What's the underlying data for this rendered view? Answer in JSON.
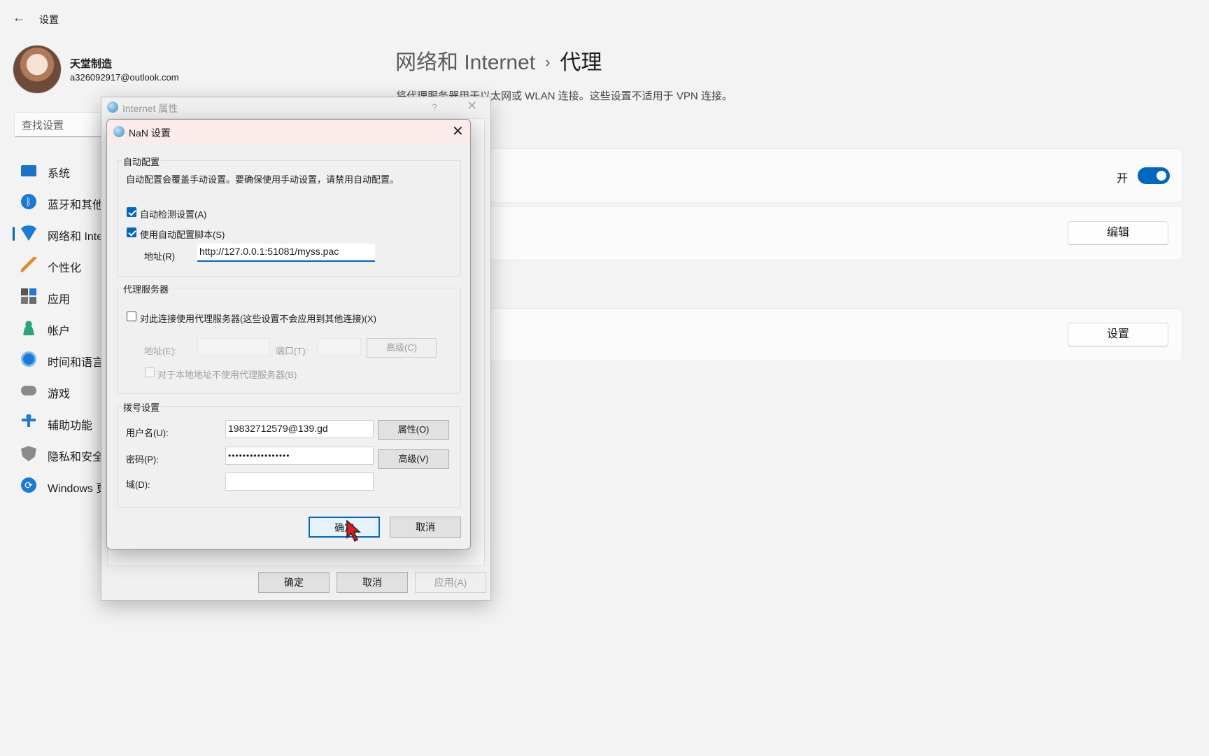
{
  "settings": {
    "app_title": "设置",
    "back_icon": "←",
    "user": {
      "name": "天堂制造",
      "email": "a326092917@outlook.com"
    },
    "search_placeholder": "查找设置",
    "nav": [
      {
        "label": "系统",
        "icon": "system-icon"
      },
      {
        "label": "蓝牙和其他",
        "icon": "bluetooth-icon"
      },
      {
        "label": "网络和 Inte",
        "icon": "wifi-icon",
        "active": true
      },
      {
        "label": "个性化",
        "icon": "brush-icon"
      },
      {
        "label": "应用",
        "icon": "apps-icon"
      },
      {
        "label": "帐户",
        "icon": "account-icon"
      },
      {
        "label": "时间和语言",
        "icon": "time-language-icon"
      },
      {
        "label": "游戏",
        "icon": "gamepad-icon"
      },
      {
        "label": "辅助功能",
        "icon": "accessibility-icon"
      },
      {
        "label": "隐私和安全",
        "icon": "shield-icon"
      },
      {
        "label": "Windows 更",
        "icon": "update-icon"
      }
    ],
    "breadcrumb": {
      "parent": "网络和 Internet",
      "separator": "›",
      "current": "代理"
    },
    "description": "将代理服务器用于以太网或 WLAN 连接。这些设置不适用于 VPN 连接。",
    "auto_detect_toggle": {
      "label": "开",
      "on": true
    },
    "edit_button": "编辑",
    "setup_button": "设置",
    "accent_color": "#0067c0"
  },
  "internet_properties": {
    "title": "Internet 属性",
    "help": "?",
    "close": "✕",
    "ok": "确定",
    "cancel": "取消",
    "apply": "应用(A)"
  },
  "lan_dialog": {
    "title": "NaN 设置",
    "close": "✕",
    "auto_config": {
      "group_title": "自动配置",
      "note": "自动配置会覆盖手动设置。要确保使用手动设置，请禁用自动配置。",
      "auto_detect": {
        "label": "自动检测设置(A)",
        "checked": true
      },
      "use_script": {
        "label": "使用自动配置脚本(S)",
        "checked": true
      },
      "address_label": "地址(R)",
      "address_value": "http://127.0.0.1:51081/myss.pac"
    },
    "proxy_server": {
      "group_title": "代理服务器",
      "use_proxy": {
        "label": "对此连接使用代理服务器(这些设置不会应用到其他连接)(X)",
        "checked": false
      },
      "address_label": "地址(E):",
      "port_label": "端口(T):",
      "advanced_button": "高级(C)",
      "bypass_local": {
        "label": "对于本地地址不使用代理服务器(B)",
        "checked": false
      }
    },
    "dialup": {
      "group_title": "拨号设置",
      "username_label": "用户名(U):",
      "username_value": "19832712579@139.gd",
      "password_label": "密码(P):",
      "password_value": "•••••••••••••••••",
      "domain_label": "域(D):",
      "domain_value": "",
      "properties_button": "属性(O)",
      "advanced_button": "高级(V)"
    },
    "ok": "确定",
    "cancel": "取消"
  }
}
